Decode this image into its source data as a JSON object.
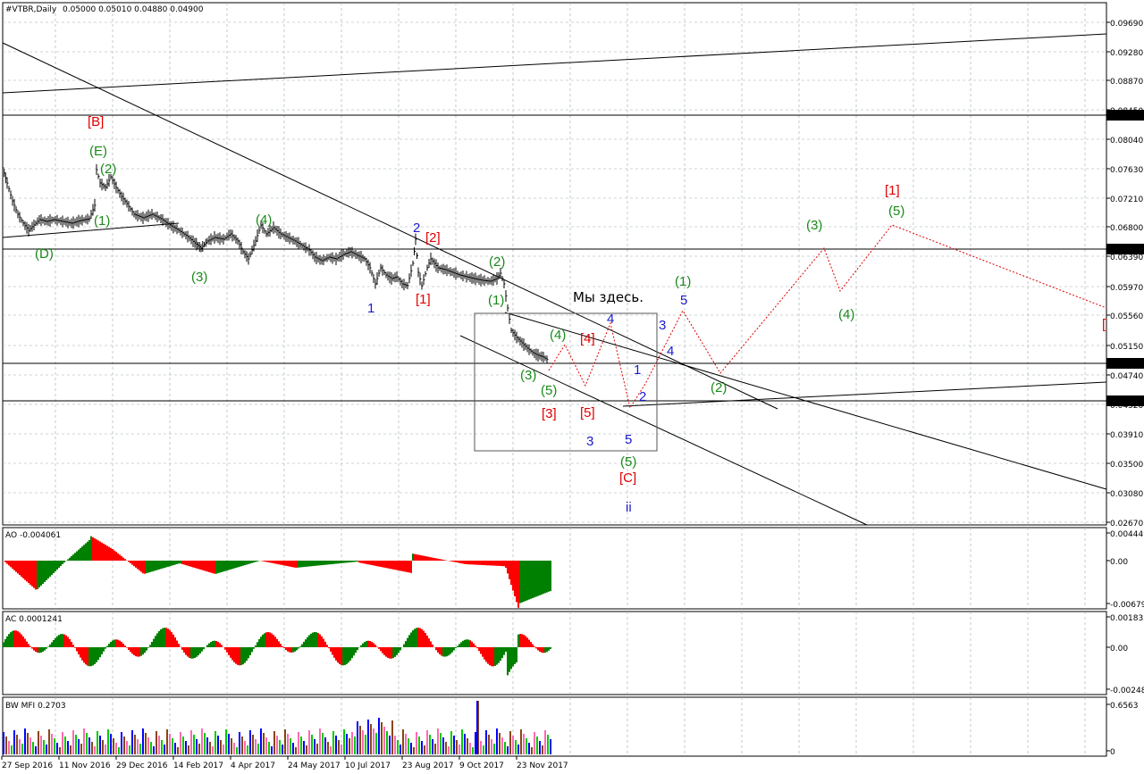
{
  "main": {
    "title": "#VTBR,Daily",
    "ohlc": "0.05000 0.05010 0.04880 0.04900",
    "price_ticks": [
      "0.09690",
      "0.09280",
      "0.08870",
      "0.08450",
      "0.08040",
      "0.07630",
      "0.07210",
      "0.06800",
      "0.06390",
      "0.05970",
      "0.05560",
      "0.05150",
      "0.04740",
      "0.04320",
      "0.03910",
      "0.03500",
      "0.03080",
      "0.02670"
    ],
    "highlight_levels": [
      {
        "label": "0.08374",
        "color": "#000000"
      },
      {
        "label": "0.06505",
        "color": "#000000"
      },
      {
        "label": "0.04900",
        "color": "#000000"
      },
      {
        "label": "0.04385",
        "color": "#000000"
      }
    ],
    "annotation": "Мы здесь."
  },
  "date_ticks": [
    "27 Sep 2016",
    "11 Nov 2016",
    "29 Dec 2016",
    "14 Feb 2017",
    "4 Apr 2017",
    "24 May 2017",
    "10 Jul 2017",
    "23 Aug 2017",
    "9 Oct 2017",
    "23 Nov 2017"
  ],
  "wave_labels": [
    {
      "text": "[B]",
      "color": "#e00000"
    },
    {
      "text": "(E)",
      "color": "#1a8a1a"
    },
    {
      "text": "(2)",
      "color": "#1a8a1a"
    },
    {
      "text": "(1)",
      "color": "#1a8a1a"
    },
    {
      "text": "(D)",
      "color": "#1a8a1a"
    },
    {
      "text": "(3)",
      "color": "#1a8a1a"
    },
    {
      "text": "(4)",
      "color": "#1a8a1a"
    },
    {
      "text": "1",
      "color": "#1a1acc"
    },
    {
      "text": "2",
      "color": "#1a1acc"
    },
    {
      "text": "[2]",
      "color": "#e00000"
    },
    {
      "text": "[1]",
      "color": "#e00000"
    },
    {
      "text": "(2)",
      "color": "#1a8a1a"
    },
    {
      "text": "(1)",
      "color": "#1a8a1a"
    },
    {
      "text": "(4)",
      "color": "#1a8a1a"
    },
    {
      "text": "[4]",
      "color": "#e00000"
    },
    {
      "text": "4",
      "color": "#1a1acc"
    },
    {
      "text": "(3)",
      "color": "#1a8a1a"
    },
    {
      "text": "(5)",
      "color": "#1a8a1a"
    },
    {
      "text": "[3]",
      "color": "#e00000"
    },
    {
      "text": "[5]",
      "color": "#e00000"
    },
    {
      "text": "3",
      "color": "#1a1acc"
    },
    {
      "text": "1",
      "color": "#1a1acc"
    },
    {
      "text": "2",
      "color": "#1a1acc"
    },
    {
      "text": "5",
      "color": "#1a1acc"
    },
    {
      "text": "(5)",
      "color": "#1a8a1a"
    },
    {
      "text": "[C]",
      "color": "#e00000"
    },
    {
      "text": "ii",
      "color": "#1a1acc"
    },
    {
      "text": "3",
      "color": "#1a1acc"
    },
    {
      "text": "4",
      "color": "#1a1acc"
    },
    {
      "text": "(1)",
      "color": "#1a8a1a"
    },
    {
      "text": "5",
      "color": "#1a1acc"
    },
    {
      "text": "(2)",
      "color": "#1a8a1a"
    },
    {
      "text": "(3)",
      "color": "#1a8a1a"
    },
    {
      "text": "(4)",
      "color": "#1a8a1a"
    },
    {
      "text": "[1]",
      "color": "#e00000"
    },
    {
      "text": "(5)",
      "color": "#1a8a1a"
    },
    {
      "text": "[",
      "color": "#e00000"
    }
  ],
  "ao": {
    "title": "AO -0.004061",
    "ticks": [
      "0.004449",
      "0.00",
      "-0.006797"
    ]
  },
  "ac": {
    "title": "AC 0.0001241",
    "ticks": [
      "0.001832",
      "0.00",
      "-0.002484"
    ]
  },
  "mfi": {
    "title": "BW MFI 0.2703",
    "ticks": [
      "0.6563",
      "0"
    ]
  },
  "colors": {
    "up": "#008000",
    "down": "#ff0000",
    "mfi_green": "#00cc00",
    "mfi_blue": "#0000ff",
    "mfi_brown": "#8b4513",
    "mfi_pink": "#ff69b4"
  }
}
